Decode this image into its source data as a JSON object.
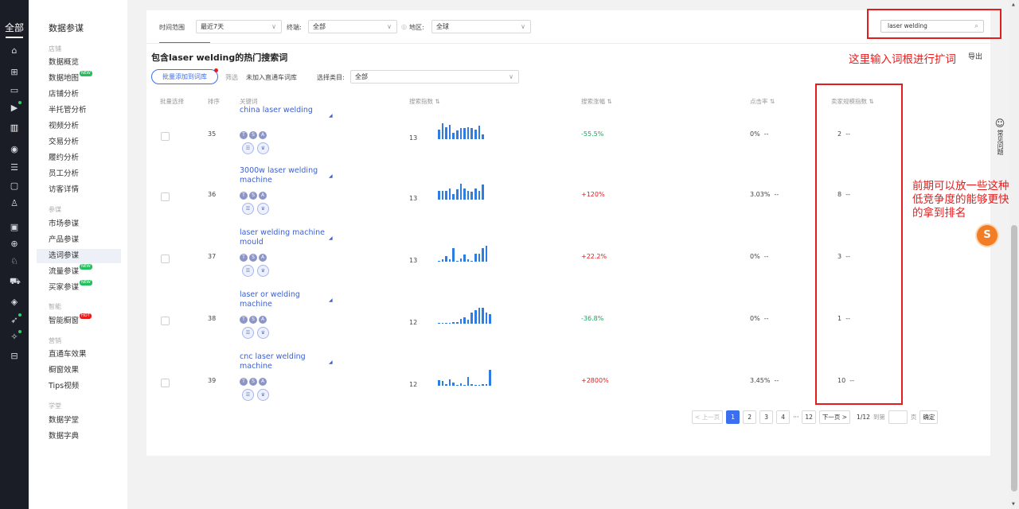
{
  "leftbar": {
    "all_label": "全部"
  },
  "nav": {
    "title": "数据参谋",
    "sections": {
      "shop": "店铺",
      "research": "参谋",
      "smart": "智能",
      "marketing": "营销",
      "study": "学堂"
    },
    "items": [
      {
        "label": "数据概览"
      },
      {
        "label": "数据地图",
        "badge": "NEW"
      },
      {
        "label": "店铺分析"
      },
      {
        "label": "半托管分析"
      },
      {
        "label": "视频分析"
      },
      {
        "label": "交易分析"
      },
      {
        "label": "履约分析"
      },
      {
        "label": "员工分析"
      },
      {
        "label": "访客详情"
      },
      {
        "label": "市场参谋"
      },
      {
        "label": "产品参谋"
      },
      {
        "label": "选词参谋"
      },
      {
        "label": "流量参谋",
        "badge": "NEW"
      },
      {
        "label": "买家参谋",
        "badge": "NEW"
      },
      {
        "label": "智能橱窗",
        "badge": "HOT"
      },
      {
        "label": "直通车效果"
      },
      {
        "label": "橱窗效果"
      },
      {
        "label": "Tips视频"
      },
      {
        "label": "数据学堂"
      },
      {
        "label": "数据字典"
      }
    ]
  },
  "filters": {
    "time_label": "时间范围",
    "time_value": "最近7天",
    "terminal_label": "终端:",
    "terminal_value": "全部",
    "region_label": "地区:",
    "region_value": "全球",
    "search_value": "laser welding"
  },
  "heading": "包含laser welding的热门搜索词",
  "export_label": "导出",
  "toolbar": {
    "batch_add_label": "批量添加到词库",
    "filter_label": "筛选",
    "filter_option": "未加入直通车词库",
    "category_label": "选择类目:",
    "category_value": "全部"
  },
  "columns": {
    "select": "批量选择",
    "rank": "排序",
    "keyword": "关键词",
    "search_index": "搜索指数",
    "search_growth": "搜索涨幅",
    "ctr": "点击率",
    "seller_scale": "卖家规模指数"
  },
  "rows": [
    {
      "rank": "35",
      "keyword": "china laser welding",
      "search_index": "13",
      "growth": "-55.5%",
      "ctr": "0%",
      "ctr_dash": "--",
      "seller": "2",
      "seller_dash": "--",
      "trend": [
        8,
        13,
        10,
        12,
        5,
        7,
        9,
        9,
        10,
        9,
        8,
        11,
        4
      ]
    },
    {
      "rank": "36",
      "keyword": "3000w laser welding machine",
      "search_index": "13",
      "growth": "+120%",
      "ctr": "3.03%",
      "ctr_dash": "--",
      "seller": "8",
      "seller_dash": "--",
      "trend": [
        8,
        8,
        8,
        10,
        5,
        9,
        14,
        10,
        8,
        7,
        10,
        8,
        13
      ]
    },
    {
      "rank": "37",
      "keyword": "laser welding machine mould",
      "search_index": "13",
      "growth": "+22.2%",
      "ctr": "0%",
      "ctr_dash": "--",
      "seller": "3",
      "seller_dash": "--",
      "trend": [
        0,
        2,
        5,
        2,
        12,
        0,
        3,
        6,
        2,
        0,
        7,
        7,
        12,
        14
      ]
    },
    {
      "rank": "38",
      "keyword": "laser or welding machine",
      "search_index": "12",
      "growth": "-36.8%",
      "ctr": "0%",
      "ctr_dash": "--",
      "seller": "1",
      "seller_dash": "--",
      "trend": [
        0,
        0,
        0,
        0,
        1,
        1,
        4,
        5,
        3,
        9,
        11,
        13,
        13,
        9,
        8
      ]
    },
    {
      "rank": "39",
      "keyword": "cnc laser welding machine",
      "search_index": "12",
      "growth": "+2800%",
      "ctr": "3.45%",
      "ctr_dash": "--",
      "seller": "10",
      "seller_dash": "--",
      "trend": [
        6,
        5,
        2,
        7,
        4,
        1,
        3,
        0,
        10,
        2,
        1,
        0,
        2,
        2,
        18
      ]
    }
  ],
  "pagination": {
    "prev": "< 上一页",
    "pages": [
      "1",
      "2",
      "3",
      "4"
    ],
    "ellipsis": "···",
    "last": "12",
    "next": "下一页 >",
    "status": "1/12",
    "goto_prefix": "到第",
    "goto_suffix": "页",
    "confirm": "确定"
  },
  "help": {
    "label": "常见问题"
  },
  "annotations": {
    "top": "这里输入词根进行扩词",
    "right": [
      "前期可以放一些这种",
      "低竞争度的能够更快",
      "的拿到排名"
    ]
  },
  "floating_badge": "S",
  "colors": {
    "accent": "#3c6ef2",
    "annotation_red": "#e31d1d",
    "sidebar_bg": "#1a1d26",
    "positive": "#e31d1d",
    "negative": "#13a85c"
  }
}
